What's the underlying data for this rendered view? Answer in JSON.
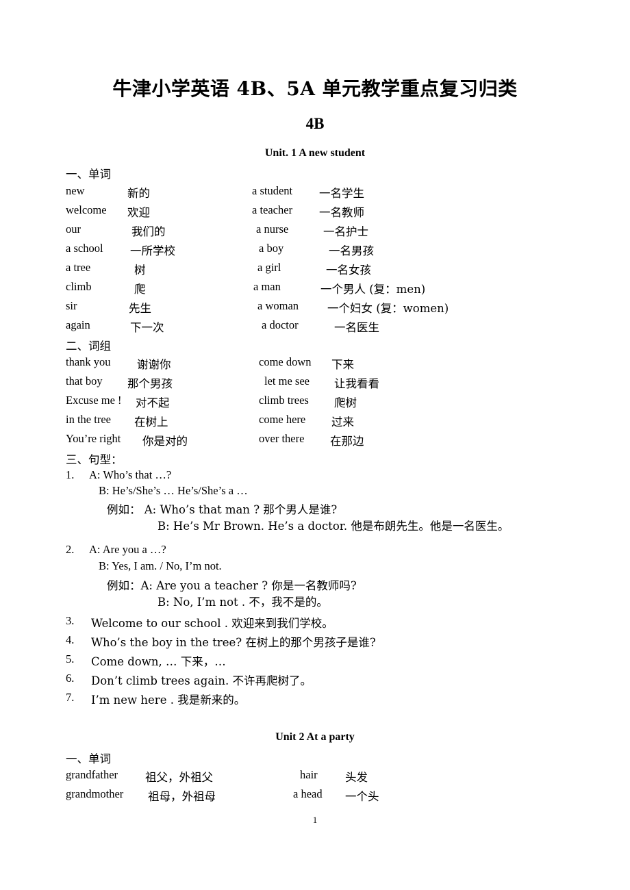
{
  "document": {
    "title": "牛津小学英语 4B、5A 单元教学重点复习归类",
    "book": "4B",
    "page_number": "1"
  },
  "units": [
    {
      "heading": "Unit. 1 A new student",
      "sections": {
        "words_label": "一、单词",
        "phrases_label": "二、词组",
        "patterns_label": "三、句型："
      },
      "words": [
        {
          "en1": "new",
          "cn1": "新的",
          "en2": "a student",
          "cn2": "一名学生"
        },
        {
          "en1": "welcome",
          "cn1": "欢迎",
          "en2": "a teacher",
          "cn2": "一名教师"
        },
        {
          "en1": "our",
          "cn1": "我们的",
          "en2": "a nurse",
          "cn2": "一名护士"
        },
        {
          "en1": "a    school",
          "cn1": "一所学校",
          "en2": "a boy",
          "cn2": "一名男孩"
        },
        {
          "en1": "a    tree",
          "cn1": "树",
          "en2": "a girl",
          "cn2": "一名女孩"
        },
        {
          "en1": "climb",
          "cn1": "爬",
          "en2": "a man",
          "cn2": "一个男人 (复：men)"
        },
        {
          "en1": "sir",
          "cn1": "先生",
          "en2": "a woman",
          "cn2": "一个妇女 (复：women)"
        },
        {
          "en1": "again",
          "cn1": "下一次",
          "en2": "a doctor",
          "cn2": "一名医生"
        }
      ],
      "phrases": [
        {
          "en1": "thank you",
          "cn1": "谢谢你",
          "en2": "come down",
          "cn2": "下来"
        },
        {
          "en1": "that boy",
          "cn1": "那个男孩",
          "en2": "let me see",
          "cn2": "让我看看"
        },
        {
          "en1": "Excuse me !",
          "cn1": "对不起",
          "en2": "climb trees",
          "cn2": "爬树"
        },
        {
          "en1": "in the tree",
          "cn1": "在树上",
          "en2": "come here",
          "cn2": "过来"
        },
        {
          "en1": "You’re right",
          "cn1": "你是对的",
          "en2": "over there",
          "cn2": "在那边"
        }
      ],
      "patterns": [
        {
          "num": "1.",
          "lines": [
            {
              "indent": 34,
              "text": "A: Who’s that …?"
            },
            {
              "indent": 48,
              "text": "B: He’s/She’s … He’s/She’s a …"
            },
            {
              "indent": 60,
              "text": "例如：    A: Who’s that man ?        那个男人是谁?"
            },
            {
              "indent": 134,
              "text": "B: He’s Mr Brown. He’s a doctor.    他是布朗先生。他是一名医生。"
            }
          ]
        },
        {
          "num": "2.",
          "lines": [
            {
              "indent": 34,
              "text": "A: Are you a …?"
            },
            {
              "indent": 48,
              "text": "B: Yes, I am. / No, I’m not."
            },
            {
              "indent": 60,
              "text": "例如：A: Are you a teacher ?     你是一名教师吗?"
            },
            {
              "indent": 134,
              "text": "B: No, I’m not .            不，我不是的。"
            }
          ]
        },
        {
          "num": "3.",
          "lines": [
            {
              "indent": 37,
              "text": "Welcome to our school .        欢迎来到我们学校。"
            }
          ]
        },
        {
          "num": "4.",
          "lines": [
            {
              "indent": 37,
              "text": "Who’s the boy in the tree?        在树上的那个男孩子是谁?"
            }
          ]
        },
        {
          "num": "5.",
          "lines": [
            {
              "indent": 37,
              "text": "Come down, …                下来，…"
            }
          ]
        },
        {
          "num": "6.",
          "lines": [
            {
              "indent": 37,
              "text": "Don’t climb trees again.     不许再爬树了。"
            }
          ]
        },
        {
          "num": "7.",
          "lines": [
            {
              "indent": 37,
              "text": "I’m new here .                我是新来的。"
            }
          ]
        }
      ]
    },
    {
      "heading": "Unit    2    At a party",
      "sections": {
        "words_label": "一、单词"
      },
      "words": [
        {
          "en1": "grandfather",
          "cn1": "祖父，外祖父",
          "en2": "hair",
          "cn2": "头发"
        },
        {
          "en1": "grandmother",
          "cn1": "祖母，外祖母",
          "en2": "a head",
          "cn2": "一个头"
        }
      ]
    }
  ]
}
